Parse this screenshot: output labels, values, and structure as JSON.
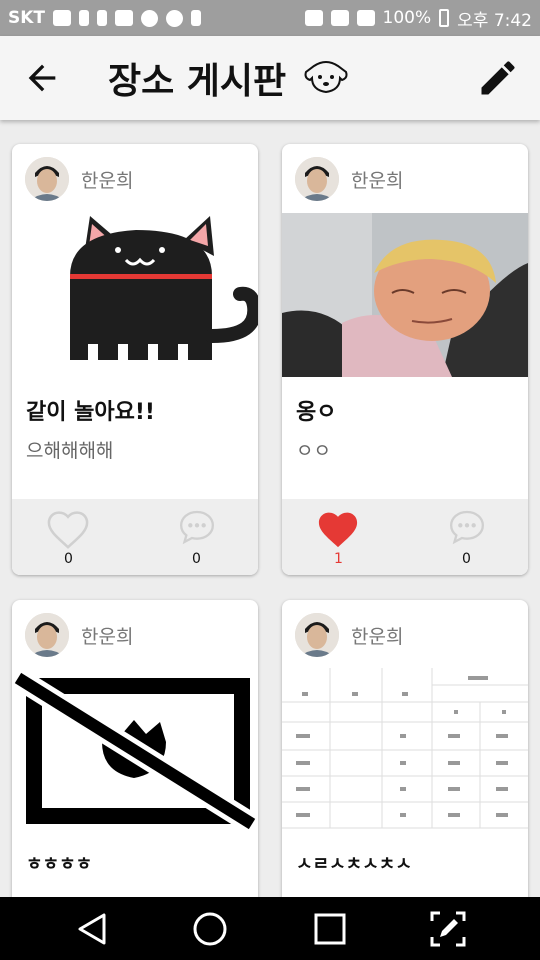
{
  "status_bar": {
    "carrier": "SKT",
    "battery": "100%",
    "time": "오후 7:42"
  },
  "app_bar": {
    "title": "장소 게시판",
    "icons": [
      "back-arrow-icon",
      "dog-face-icon",
      "pencil-icon"
    ]
  },
  "posts": [
    {
      "username": "한운희",
      "image": "cat-illustration",
      "title": "같이 놀아요!!",
      "body": "으해해해해",
      "likes": "0",
      "comments": "0",
      "liked": false
    },
    {
      "username": "한운희",
      "image": "person-photo",
      "title": "옹ㅇ",
      "body": "ㅇㅇ",
      "likes": "1",
      "comments": "0",
      "liked": true
    },
    {
      "username": "한운희",
      "image": "no-image-placeholder",
      "title": "ㅎㅎㅎㅎ",
      "body": "",
      "likes": "",
      "comments": "",
      "liked": false
    },
    {
      "username": "한운희",
      "image": "table-document",
      "title": "ㅅㄹㅅㅊㅅㅊㅅ",
      "body": "",
      "likes": "",
      "comments": "",
      "liked": false
    }
  ],
  "nav_bar": {
    "icons": [
      "back-triangle-icon",
      "home-circle-icon",
      "recents-square-icon",
      "screenshot-edit-icon"
    ]
  },
  "colors": {
    "like_active": "#e53935",
    "icon_gray": "#d0d0d0",
    "app_bar": "#f5f5f5"
  }
}
